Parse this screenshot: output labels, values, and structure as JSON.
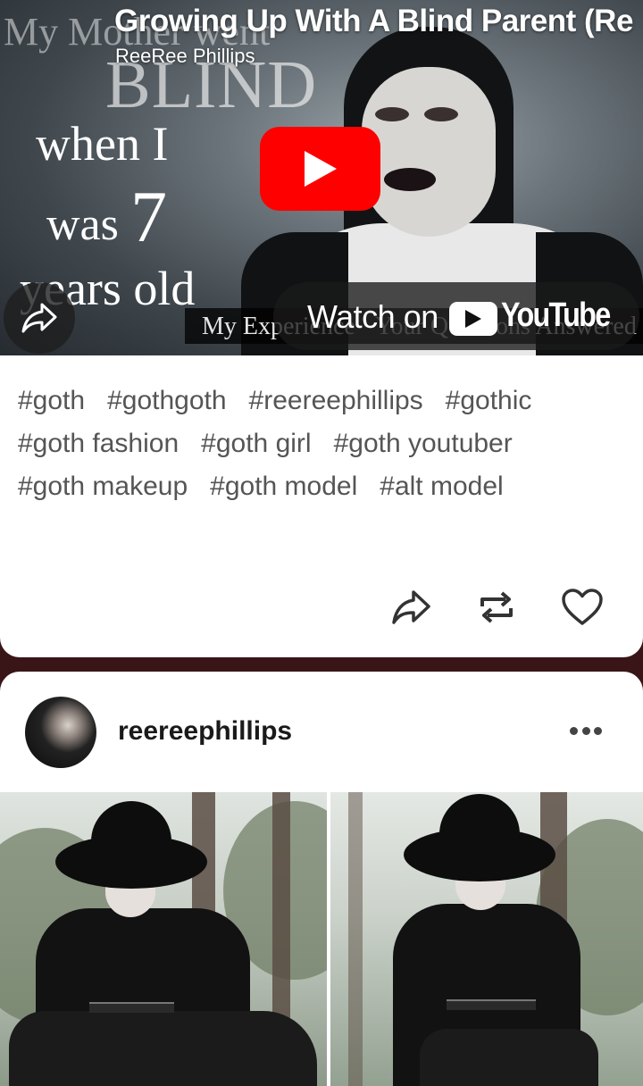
{
  "video_post": {
    "video_title": "Growing Up With A Blind Parent (Re",
    "channel": "ReeRee Phillips",
    "thumbnail_text": {
      "line1": "My Mother went",
      "line2": "BLIND",
      "line3": "when I",
      "line4a": "was",
      "line4b": "7",
      "line5": "years old",
      "subtitle": "My Experience · Your Questions Answered"
    },
    "watch_on": "Watch on",
    "youtube_word": "YouTube",
    "tags": [
      "#goth",
      "#gothgoth",
      "#reereephillips",
      "#gothic",
      "#goth fashion",
      "#goth girl",
      "#goth youtuber",
      "#goth makeup",
      "#goth model",
      "#alt model"
    ],
    "actions": [
      "share-icon",
      "reblog-icon",
      "heart-icon"
    ]
  },
  "photo_post": {
    "username": "reereephillips",
    "menu_icon": "more-icon"
  },
  "colors": {
    "page_background": "#3a1517",
    "youtube_red": "#ff0000",
    "tag_text": "#555555",
    "card_background": "#ffffff"
  }
}
